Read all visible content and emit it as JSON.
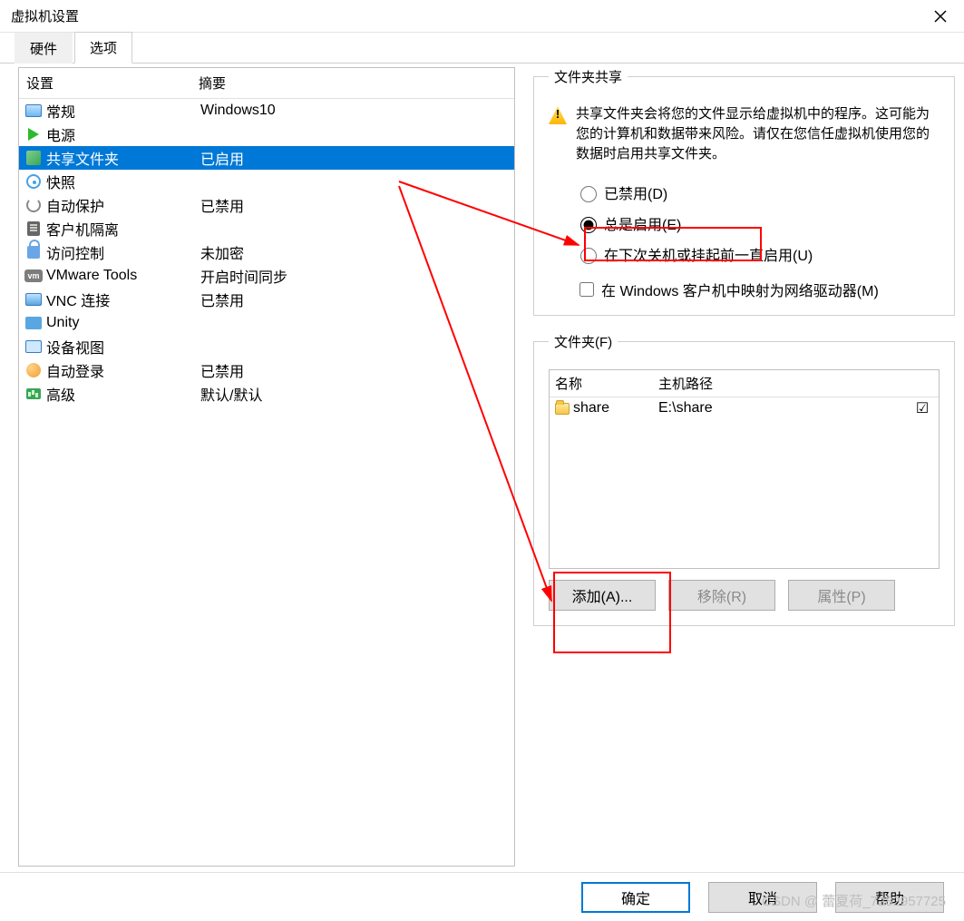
{
  "window": {
    "title": "虚拟机设置"
  },
  "tabs": {
    "hardware": "硬件",
    "options": "选项"
  },
  "list": {
    "header_setting": "设置",
    "header_summary": "摘要",
    "rows": [
      {
        "name": "常规",
        "summary": "Windows10"
      },
      {
        "name": "电源",
        "summary": ""
      },
      {
        "name": "共享文件夹",
        "summary": "已启用"
      },
      {
        "name": "快照",
        "summary": ""
      },
      {
        "name": "自动保护",
        "summary": "已禁用"
      },
      {
        "name": "客户机隔离",
        "summary": ""
      },
      {
        "name": "访问控制",
        "summary": "未加密"
      },
      {
        "name": "VMware Tools",
        "summary": "开启时间同步"
      },
      {
        "name": "VNC 连接",
        "summary": "已禁用"
      },
      {
        "name": "Unity",
        "summary": ""
      },
      {
        "name": "设备视图",
        "summary": ""
      },
      {
        "name": "自动登录",
        "summary": "已禁用"
      },
      {
        "name": "高级",
        "summary": "默认/默认"
      }
    ]
  },
  "share": {
    "legend": "文件夹共享",
    "warning": "共享文件夹会将您的文件显示给虚拟机中的程序。这可能为您的计算机和数据带来风险。请仅在您信任虚拟机使用您的数据时启用共享文件夹。",
    "radio_disabled": "已禁用(D)",
    "radio_always": "总是启用(E)",
    "radio_until": "在下次关机或挂起前一直启用(U)",
    "map_drive": "在 Windows 客户机中映射为网络驱动器(M)"
  },
  "folders": {
    "legend": "文件夹(F)",
    "hdr_name": "名称",
    "hdr_path": "主机路径",
    "rows": [
      {
        "name": "share",
        "path": "E:\\share",
        "checked": true
      }
    ],
    "btn_add": "添加(A)...",
    "btn_remove": "移除(R)",
    "btn_props": "属性(P)"
  },
  "footer": {
    "ok": "确定",
    "cancel": "取消",
    "help": "帮助"
  },
  "watermark": "CSDN @ 蕾夏荷_7282957725"
}
